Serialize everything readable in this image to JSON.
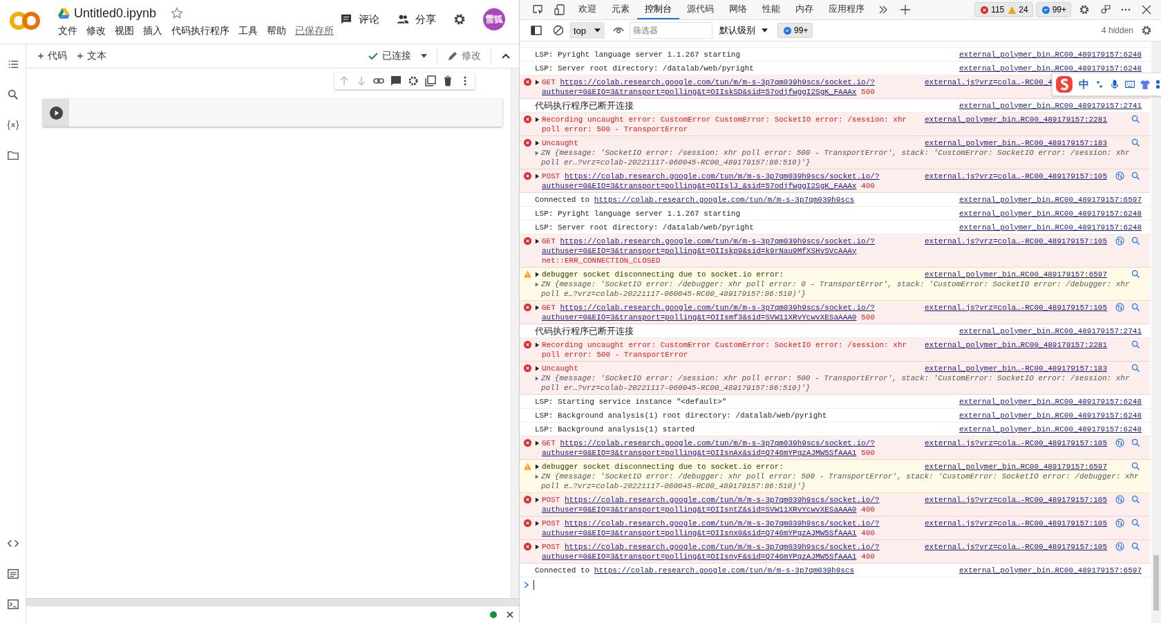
{
  "colab": {
    "title": "Untitled0.ipynb",
    "menu": [
      "文件",
      "修改",
      "视图",
      "插入",
      "代码执行程序",
      "工具",
      "帮助"
    ],
    "saved": "已保存所",
    "comment": "评论",
    "share": "分享",
    "avatar": "雪狐",
    "add_code": "代码",
    "add_text": "文本",
    "connection": "已连接",
    "edit": "修改"
  },
  "devtools": {
    "tabs": [
      {
        "label": "欢迎",
        "selected": false
      },
      {
        "label": "元素",
        "selected": false
      },
      {
        "label": "控制台",
        "selected": true
      },
      {
        "label": "源代码",
        "selected": false
      },
      {
        "label": "网络",
        "selected": false
      },
      {
        "label": "性能",
        "selected": false
      },
      {
        "label": "内存",
        "selected": false
      },
      {
        "label": "应用程序",
        "selected": false
      }
    ],
    "errors": "115",
    "warnings": "24",
    "messages": "99+",
    "context": "top",
    "filter_placeholder": "筛选器",
    "level": "默认级别",
    "badge": "99+",
    "hidden": "4 hidden"
  },
  "ime_toolbar": {
    "mode": "中"
  },
  "console": [
    {
      "kind": "log",
      "expandable": false,
      "text": "LSP: Pyright language server 1.1.267 starting",
      "source": "external_polymer_bin…RC00_489179157:6248",
      "network_icon": false,
      "search_icon": false
    },
    {
      "kind": "log",
      "expandable": false,
      "text": "LSP: Server root directory: /datalab/web/pyright",
      "source": "external_polymer_bin…RC00_489179157:6248",
      "network_icon": false,
      "search_icon": false
    },
    {
      "kind": "error",
      "expandable": true,
      "text": "GET",
      "url": "https://colab.research.google.com/tun/m/m-s-3p7qm039h9scs/socket.io/?authuser=0&EIO=3&transport=polling&t=OIIskSD&sid=57odjfwggI2SgK_FAAAx",
      "status": "500",
      "source": "external.js?vrz=cola…-RC00_4",
      "network_icon": false,
      "search_icon": false
    },
    {
      "kind": "log",
      "expandable": false,
      "text": "代码执行程序已断开连接",
      "source": "external_polymer_bin…RC00_489179157:2741",
      "network_icon": false,
      "search_icon": false
    },
    {
      "kind": "error",
      "expandable": true,
      "text": "Recording uncaught error: CustomError CustomError: SocketIO error: /session: xhr poll error: 500 - TransportError",
      "source": "external_polymer_bin…RC00_489179157:2281",
      "network_icon": false,
      "search_icon": true
    },
    {
      "kind": "error",
      "expandable": true,
      "text": "Uncaught",
      "detail": "ZN {message: 'SocketIO error: /session: xhr poll error: 500 - TransportError', stack: 'CustomError: SocketIO error: /session: xhr poll er…?vrz=colab-20221117-060045-RC00_489179157:86:510)'}",
      "source": "external_polymer_bin…-RC00_489179157:183",
      "network_icon": false,
      "search_icon": true
    },
    {
      "kind": "error",
      "expandable": true,
      "text": "POST",
      "url": "https://colab.research.google.com/tun/m/m-s-3p7qm039h9scs/socket.io/?authuser=0&EIO=3&transport=polling&t=OIIslJ_&sid=57odjfwggI2SgK_FAAAx",
      "status": "400",
      "source": "external.js?vrz=cola…-RC00_489179157:105",
      "network_icon": true,
      "search_icon": true
    },
    {
      "kind": "log",
      "expandable": false,
      "text": "Connected to",
      "url": "https://colab.research.google.com/tun/m/m-s-3p7qm039h9scs",
      "source": "external_polymer_bin…RC00_489179157:6597",
      "network_icon": false,
      "search_icon": false
    },
    {
      "kind": "log",
      "expandable": false,
      "text": "LSP: Pyright language server 1.1.267 starting",
      "source": "external_polymer_bin…RC00_489179157:6248",
      "network_icon": false,
      "search_icon": false
    },
    {
      "kind": "log",
      "expandable": false,
      "text": "LSP: Server root directory: /datalab/web/pyright",
      "source": "external_polymer_bin…RC00_489179157:6248",
      "network_icon": false,
      "search_icon": false
    },
    {
      "kind": "error",
      "expandable": true,
      "text": "GET",
      "url": "https://colab.research.google.com/tun/m/m-s-3p7qm039h9scs/socket.io/?authuser=0&EIO=3&transport=polling&t=OIIskp9&sid=k9rNau9MfXSHvSVcAAAy",
      "note": "net::ERR_CONNECTION_CLOSED",
      "source": "external.js?vrz=cola…-RC00_489179157:105",
      "network_icon": true,
      "search_icon": true
    },
    {
      "kind": "warning",
      "expandable": true,
      "text": "debugger socket disconnecting due to socket.io error:",
      "detail": "ZN {message: 'SocketIO error: /debugger: xhr poll error: 0 - TransportError', stack: 'CustomError: SocketIO error: /debugger: xhr poll e…?vrz=colab-20221117-060045-RC00_489179157:86:510)'}",
      "source": "external_polymer_bin…RC00_489179157:6597",
      "network_icon": false,
      "search_icon": true
    },
    {
      "kind": "error",
      "expandable": true,
      "text": "GET",
      "url": "https://colab.research.google.com/tun/m/m-s-3p7qm039h9scs/socket.io/?authuser=0&EIO=3&transport=polling&t=OIIsmf3&sid=SVW11XRvYcwvXESaAAA0",
      "status": "500",
      "source": "external.js?vrz=cola…-RC00_489179157:105",
      "network_icon": true,
      "search_icon": true
    },
    {
      "kind": "log",
      "expandable": false,
      "text": "代码执行程序已断开连接",
      "source": "external_polymer_bin…RC00_489179157:2741",
      "network_icon": false,
      "search_icon": false
    },
    {
      "kind": "error",
      "expandable": true,
      "text": "Recording uncaught error: CustomError CustomError: SocketIO error: /session: xhr poll error: 500 - TransportError",
      "source": "external_polymer_bin…RC00_489179157:2281",
      "network_icon": false,
      "search_icon": true
    },
    {
      "kind": "error",
      "expandable": true,
      "text": "Uncaught",
      "detail": "ZN {message: 'SocketIO error: /session: xhr poll error: 500 - TransportError', stack: 'CustomError: SocketIO error: /session: xhr poll er…?vrz=colab-20221117-060045-RC00_489179157:86:510)'}",
      "source": "external_polymer_bin…-RC00_489179157:183",
      "network_icon": false,
      "search_icon": true
    },
    {
      "kind": "log",
      "expandable": false,
      "text": "LSP: Starting service instance \"<default>\"",
      "source": "external_polymer_bin…RC00_489179157:6248",
      "network_icon": false,
      "search_icon": false
    },
    {
      "kind": "log",
      "expandable": false,
      "text": "LSP: Background analysis(1) root directory: /datalab/web/pyright",
      "source": "external_polymer_bin…RC00_489179157:6248",
      "network_icon": false,
      "search_icon": false
    },
    {
      "kind": "log",
      "expandable": false,
      "text": "LSP: Background analysis(1) started",
      "source": "external_polymer_bin…RC00_489179157:6248",
      "network_icon": false,
      "search_icon": false
    },
    {
      "kind": "error",
      "expandable": true,
      "text": "GET",
      "url": "https://colab.research.google.com/tun/m/m-s-3p7qm039h9scs/socket.io/?authuser=0&EIO=3&transport=polling&t=OIIsnAx&sid=Q746mYPqzAJMW5SfAAA1",
      "status": "500",
      "source": "external.js?vrz=cola…-RC00_489179157:105",
      "network_icon": true,
      "search_icon": true
    },
    {
      "kind": "warning",
      "expandable": true,
      "text": "debugger socket disconnecting due to socket.io error:",
      "detail": "ZN {message: 'SocketIO error: /debugger: xhr poll error: 500 - TransportError', stack: 'CustomError: SocketIO error: /debugger: xhr poll e…?vrz=colab-20221117-060045-RC00_489179157:86:510)'}",
      "source": "external_polymer_bin…RC00_489179157:6597",
      "network_icon": false,
      "search_icon": true
    },
    {
      "kind": "error",
      "expandable": true,
      "text": "POST",
      "url": "https://colab.research.google.com/tun/m/m-s-3p7qm039h9scs/socket.io/?authuser=0&EIO=3&transport=polling&t=OIIsntZ&sid=SVW11XRvYcwvXESaAAA0",
      "status": "400",
      "source": "external.js?vrz=cola…-RC00_489179157:105",
      "network_icon": true,
      "search_icon": true
    },
    {
      "kind": "error",
      "expandable": true,
      "text": "POST",
      "url": "https://colab.research.google.com/tun/m/m-s-3p7qm039h9scs/socket.io/?authuser=0&EIO=3&transport=polling&t=OIIsnx0&sid=Q746mYPqzAJMW5SfAAA1",
      "status": "400",
      "source": "external.js?vrz=cola…-RC00_489179157:105",
      "network_icon": true,
      "search_icon": true
    },
    {
      "kind": "error",
      "expandable": true,
      "text": "POST",
      "url": "https://colab.research.google.com/tun/m/m-s-3p7qm039h9scs/socket.io/?authuser=0&EIO=3&transport=polling&t=OIIsnyF&sid=Q746mYPqzAJMW5SfAAA1",
      "status": "400",
      "source": "external.js?vrz=cola…-RC00_489179157:105",
      "network_icon": true,
      "search_icon": true
    },
    {
      "kind": "log",
      "expandable": false,
      "text": "Connected to",
      "url": "https://colab.research.google.com/tun/m/m-s-3p7qm039h9scs",
      "source": "external_polymer_bin…RC00_489179157:6597",
      "network_icon": false,
      "search_icon": false
    }
  ]
}
